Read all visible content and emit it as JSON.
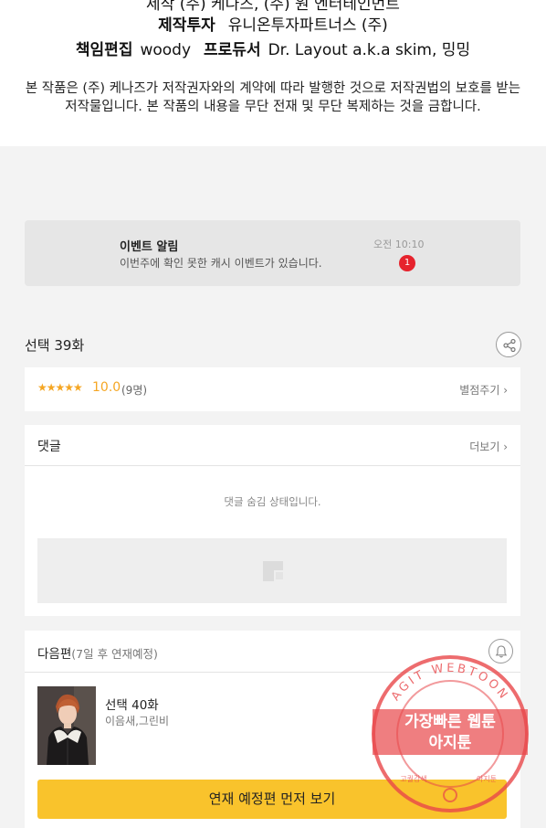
{
  "credits": {
    "cut_line": "제작 (주) 케나즈, (주) 원 엔터테인먼트",
    "invest_label": "제작투자",
    "invest_value": "유니온투자파트너스 (주)",
    "editor_label": "책임편집",
    "editor_value": "woody",
    "producer_label": "프로듀서",
    "producer_value": "Dr. Layout a.k.a skim, 밍밍",
    "notice": "본 작품은 (주) 케나즈가 저작권자와의 계약에 따라 발행한 것으로 저작권법의 보호를 받는 저작물입니다. 본 작품의 내용을 무단 전재 및 무단 복제하는 것을 금합니다."
  },
  "event": {
    "title": "이벤트 알림",
    "description": "이번주에 확인 못한 캐시 이벤트가 있습니다.",
    "time": "오전 10:10",
    "badge": "1"
  },
  "episode": {
    "title": "선택 39화",
    "share_icon": "share-icon"
  },
  "rating": {
    "stars": "★★★★★",
    "score": "10.0",
    "count": "(9명)",
    "rate_label": "별점주기 ›"
  },
  "comments": {
    "title": "댓글",
    "more_label": "더보기 ›",
    "hidden_message": "댓글 숨김 상태입니다."
  },
  "next": {
    "title": "다음편",
    "schedule": "(7일 후 연재예정)",
    "episode_title": "선택 40화",
    "authors": "이음새,그린비",
    "preview_button": "연재 예정편 먼저 보기",
    "bell_icon": "bell-icon"
  },
  "watermark": {
    "top_text": "AGIT WEBTOON",
    "line1": "가장빠른 웹툰",
    "line2": "아지툰",
    "bottom_left": "고퀄감색",
    "bottom_right": "아지툰"
  },
  "colors": {
    "accent_yellow": "#f9c32c",
    "star_orange": "#f5a623",
    "badge_red": "#e6232d",
    "watermark_red": "#e8474a"
  }
}
